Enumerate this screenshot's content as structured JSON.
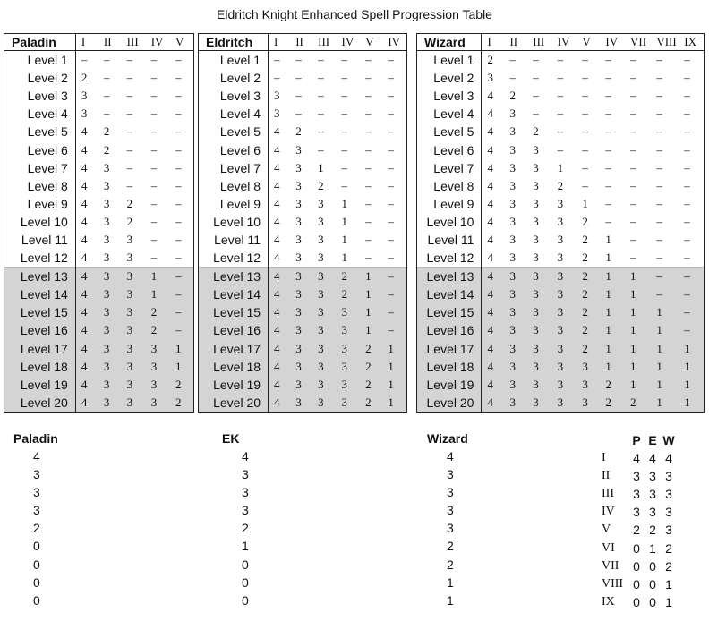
{
  "title": "Eldritch Knight Enhanced Spell Progression Table",
  "tables": [
    {
      "name": "Paladin",
      "columns": [
        "I",
        "II",
        "III",
        "IV",
        "V"
      ],
      "rows": [
        {
          "level": "Level 1",
          "vals": [
            "–",
            "–",
            "–",
            "–",
            "–"
          ]
        },
        {
          "level": "Level 2",
          "vals": [
            "2",
            "–",
            "–",
            "–",
            "–"
          ]
        },
        {
          "level": "Level 3",
          "vals": [
            "3",
            "–",
            "–",
            "–",
            "–"
          ]
        },
        {
          "level": "Level 4",
          "vals": [
            "3",
            "–",
            "–",
            "–",
            "–"
          ]
        },
        {
          "level": "Level 5",
          "vals": [
            "4",
            "2",
            "–",
            "–",
            "–"
          ]
        },
        {
          "level": "Level 6",
          "vals": [
            "4",
            "2",
            "–",
            "–",
            "–"
          ]
        },
        {
          "level": "Level 7",
          "vals": [
            "4",
            "3",
            "–",
            "–",
            "–"
          ]
        },
        {
          "level": "Level 8",
          "vals": [
            "4",
            "3",
            "–",
            "–",
            "–"
          ]
        },
        {
          "level": "Level 9",
          "vals": [
            "4",
            "3",
            "2",
            "–",
            "–"
          ]
        },
        {
          "level": "Level 10",
          "vals": [
            "4",
            "3",
            "2",
            "–",
            "–"
          ]
        },
        {
          "level": "Level 11",
          "vals": [
            "4",
            "3",
            "3",
            "–",
            "–"
          ]
        },
        {
          "level": "Level 12",
          "vals": [
            "4",
            "3",
            "3",
            "–",
            "–"
          ]
        },
        {
          "level": "Level 13",
          "vals": [
            "4",
            "3",
            "3",
            "1",
            "–"
          ]
        },
        {
          "level": "Level 14",
          "vals": [
            "4",
            "3",
            "3",
            "1",
            "–"
          ]
        },
        {
          "level": "Level 15",
          "vals": [
            "4",
            "3",
            "3",
            "2",
            "–"
          ]
        },
        {
          "level": "Level 16",
          "vals": [
            "4",
            "3",
            "3",
            "2",
            "–"
          ]
        },
        {
          "level": "Level 17",
          "vals": [
            "4",
            "3",
            "3",
            "3",
            "1"
          ]
        },
        {
          "level": "Level 18",
          "vals": [
            "4",
            "3",
            "3",
            "3",
            "1"
          ]
        },
        {
          "level": "Level 19",
          "vals": [
            "4",
            "3",
            "3",
            "3",
            "2"
          ]
        },
        {
          "level": "Level 20",
          "vals": [
            "4",
            "3",
            "3",
            "3",
            "2"
          ]
        }
      ]
    },
    {
      "name": "Eldritch",
      "columns": [
        "I",
        "II",
        "III",
        "IV",
        "V",
        "IV"
      ],
      "rows": [
        {
          "level": "Level 1",
          "vals": [
            "–",
            "–",
            "–",
            "–",
            "–",
            "–"
          ]
        },
        {
          "level": "Level 2",
          "vals": [
            "–",
            "–",
            "–",
            "–",
            "–",
            "–"
          ]
        },
        {
          "level": "Level 3",
          "vals": [
            "3",
            "–",
            "–",
            "–",
            "–",
            "–"
          ]
        },
        {
          "level": "Level 4",
          "vals": [
            "3",
            "–",
            "–",
            "–",
            "–",
            "–"
          ]
        },
        {
          "level": "Level 5",
          "vals": [
            "4",
            "2",
            "–",
            "–",
            "–",
            "–"
          ]
        },
        {
          "level": "Level 6",
          "vals": [
            "4",
            "3",
            "–",
            "–",
            "–",
            "–"
          ]
        },
        {
          "level": "Level 7",
          "vals": [
            "4",
            "3",
            "1",
            "–",
            "–",
            "–"
          ]
        },
        {
          "level": "Level 8",
          "vals": [
            "4",
            "3",
            "2",
            "–",
            "–",
            "–"
          ]
        },
        {
          "level": "Level 9",
          "vals": [
            "4",
            "3",
            "3",
            "1",
            "–",
            "–"
          ]
        },
        {
          "level": "Level 10",
          "vals": [
            "4",
            "3",
            "3",
            "1",
            "–",
            "–"
          ]
        },
        {
          "level": "Level 11",
          "vals": [
            "4",
            "3",
            "3",
            "1",
            "–",
            "–"
          ]
        },
        {
          "level": "Level 12",
          "vals": [
            "4",
            "3",
            "3",
            "1",
            "–",
            "–"
          ]
        },
        {
          "level": "Level 13",
          "vals": [
            "4",
            "3",
            "3",
            "2",
            "1",
            "–"
          ]
        },
        {
          "level": "Level 14",
          "vals": [
            "4",
            "3",
            "3",
            "2",
            "1",
            "–"
          ]
        },
        {
          "level": "Level 15",
          "vals": [
            "4",
            "3",
            "3",
            "3",
            "1",
            "–"
          ]
        },
        {
          "level": "Level 16",
          "vals": [
            "4",
            "3",
            "3",
            "3",
            "1",
            "–"
          ]
        },
        {
          "level": "Level 17",
          "vals": [
            "4",
            "3",
            "3",
            "3",
            "2",
            "1"
          ]
        },
        {
          "level": "Level 18",
          "vals": [
            "4",
            "3",
            "3",
            "3",
            "2",
            "1"
          ]
        },
        {
          "level": "Level 19",
          "vals": [
            "4",
            "3",
            "3",
            "3",
            "2",
            "1"
          ]
        },
        {
          "level": "Level 20",
          "vals": [
            "4",
            "3",
            "3",
            "3",
            "2",
            "1"
          ]
        }
      ]
    },
    {
      "name": "Wizard",
      "columns": [
        "I",
        "II",
        "III",
        "IV",
        "V",
        "IV",
        "VII",
        "VIII",
        "IX"
      ],
      "rows": [
        {
          "level": "Level 1",
          "vals": [
            "2",
            "–",
            "–",
            "–",
            "–",
            "–",
            "–",
            "–",
            "–"
          ]
        },
        {
          "level": "Level 2",
          "vals": [
            "3",
            "–",
            "–",
            "–",
            "–",
            "–",
            "–",
            "–",
            "–"
          ]
        },
        {
          "level": "Level 3",
          "vals": [
            "4",
            "2",
            "–",
            "–",
            "–",
            "–",
            "–",
            "–",
            "–"
          ]
        },
        {
          "level": "Level 4",
          "vals": [
            "4",
            "3",
            "–",
            "–",
            "–",
            "–",
            "–",
            "–",
            "–"
          ]
        },
        {
          "level": "Level 5",
          "vals": [
            "4",
            "3",
            "2",
            "–",
            "–",
            "–",
            "–",
            "–",
            "–"
          ]
        },
        {
          "level": "Level 6",
          "vals": [
            "4",
            "3",
            "3",
            "–",
            "–",
            "–",
            "–",
            "–",
            "–"
          ]
        },
        {
          "level": "Level 7",
          "vals": [
            "4",
            "3",
            "3",
            "1",
            "–",
            "–",
            "–",
            "–",
            "–"
          ]
        },
        {
          "level": "Level 8",
          "vals": [
            "4",
            "3",
            "3",
            "2",
            "–",
            "–",
            "–",
            "–",
            "–"
          ]
        },
        {
          "level": "Level 9",
          "vals": [
            "4",
            "3",
            "3",
            "3",
            "1",
            "–",
            "–",
            "–",
            "–"
          ]
        },
        {
          "level": "Level 10",
          "vals": [
            "4",
            "3",
            "3",
            "3",
            "2",
            "–",
            "–",
            "–",
            "–"
          ]
        },
        {
          "level": "Level 11",
          "vals": [
            "4",
            "3",
            "3",
            "3",
            "2",
            "1",
            "–",
            "–",
            "–"
          ]
        },
        {
          "level": "Level 12",
          "vals": [
            "4",
            "3",
            "3",
            "3",
            "2",
            "1",
            "–",
            "–",
            "–"
          ]
        },
        {
          "level": "Level 13",
          "vals": [
            "4",
            "3",
            "3",
            "3",
            "2",
            "1",
            "1",
            "–",
            "–"
          ]
        },
        {
          "level": "Level 14",
          "vals": [
            "4",
            "3",
            "3",
            "3",
            "2",
            "1",
            "1",
            "–",
            "–"
          ]
        },
        {
          "level": "Level 15",
          "vals": [
            "4",
            "3",
            "3",
            "3",
            "2",
            "1",
            "1",
            "1",
            "–"
          ]
        },
        {
          "level": "Level 16",
          "vals": [
            "4",
            "3",
            "3",
            "3",
            "2",
            "1",
            "1",
            "1",
            "–"
          ]
        },
        {
          "level": "Level 17",
          "vals": [
            "4",
            "3",
            "3",
            "3",
            "2",
            "1",
            "1",
            "1",
            "1"
          ]
        },
        {
          "level": "Level 18",
          "vals": [
            "4",
            "3",
            "3",
            "3",
            "3",
            "1",
            "1",
            "1",
            "1"
          ]
        },
        {
          "level": "Level 19",
          "vals": [
            "4",
            "3",
            "3",
            "3",
            "3",
            "2",
            "1",
            "1",
            "1"
          ]
        },
        {
          "level": "Level 20",
          "vals": [
            "4",
            "3",
            "3",
            "3",
            "3",
            "2",
            "2",
            "1",
            "1"
          ]
        }
      ]
    }
  ],
  "summaries": [
    {
      "heading": "Paladin",
      "values": [
        "4",
        "3",
        "3",
        "3",
        "2",
        "0",
        "0",
        "0",
        "0"
      ]
    },
    {
      "heading": "EK",
      "values": [
        "4",
        "3",
        "3",
        "3",
        "2",
        "1",
        "0",
        "0",
        "0"
      ]
    },
    {
      "heading": "Wizard",
      "values": [
        "4",
        "3",
        "3",
        "3",
        "3",
        "2",
        "2",
        "1",
        "1"
      ]
    }
  ],
  "comparison": {
    "headers": [
      "P",
      "E",
      "W"
    ],
    "rows": [
      {
        "label": "I",
        "vals": [
          "4",
          "4",
          "4"
        ]
      },
      {
        "label": "II",
        "vals": [
          "3",
          "3",
          "3"
        ]
      },
      {
        "label": "III",
        "vals": [
          "3",
          "3",
          "3"
        ]
      },
      {
        "label": "IV",
        "vals": [
          "3",
          "3",
          "3"
        ]
      },
      {
        "label": "V",
        "vals": [
          "2",
          "2",
          "3"
        ]
      },
      {
        "label": "VI",
        "vals": [
          "0",
          "1",
          "2"
        ]
      },
      {
        "label": "VII",
        "vals": [
          "0",
          "0",
          "2"
        ]
      },
      {
        "label": "VIII",
        "vals": [
          "0",
          "0",
          "1"
        ]
      },
      {
        "label": "IX",
        "vals": [
          "0",
          "0",
          "1"
        ]
      }
    ]
  }
}
